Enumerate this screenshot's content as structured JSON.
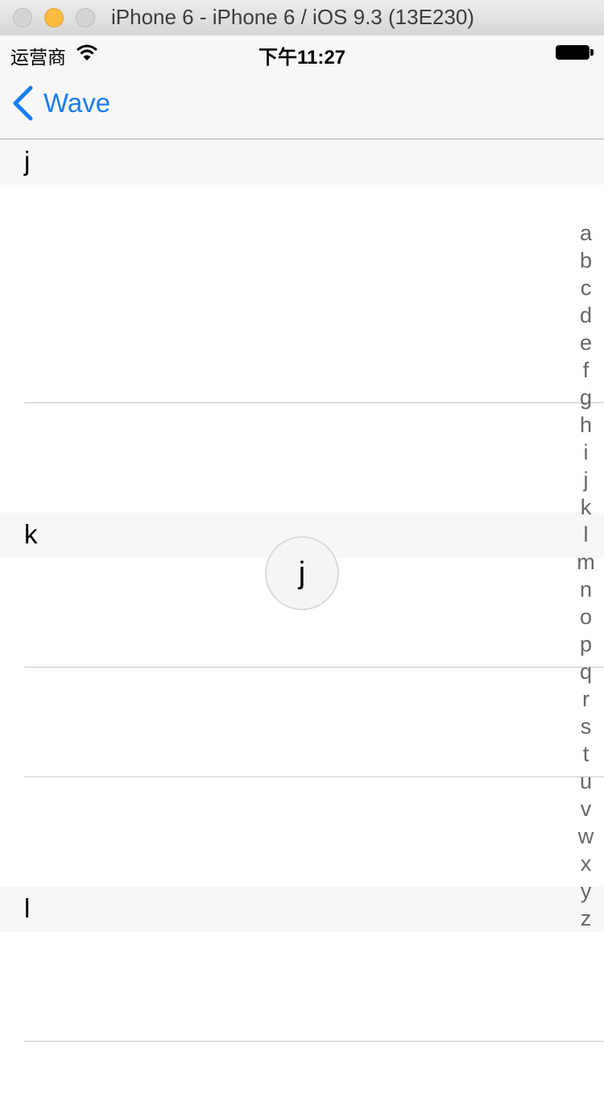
{
  "window": {
    "title": "iPhone 6 - iPhone 6 / iOS 9.3 (13E230)"
  },
  "status_bar": {
    "carrier": "运营商",
    "time": "下午11:27"
  },
  "nav": {
    "back_label": "Wave"
  },
  "sections": [
    {
      "title": "j",
      "rows": 3
    },
    {
      "title": "k",
      "rows": 3
    },
    {
      "title": "l",
      "rows": 2
    }
  ],
  "index_letters": [
    "a",
    "b",
    "c",
    "d",
    "e",
    "f",
    "g",
    "h",
    "i",
    "j",
    "k",
    "l",
    "m",
    "n",
    "o",
    "p",
    "q",
    "r",
    "s",
    "t",
    "u",
    "v",
    "w",
    "x",
    "y",
    "z"
  ],
  "bubble": {
    "letter": "j"
  },
  "colors": {
    "tint": "#1a7cf4",
    "header_bg": "#f7f7f7",
    "separator": "#c8c7cc"
  }
}
